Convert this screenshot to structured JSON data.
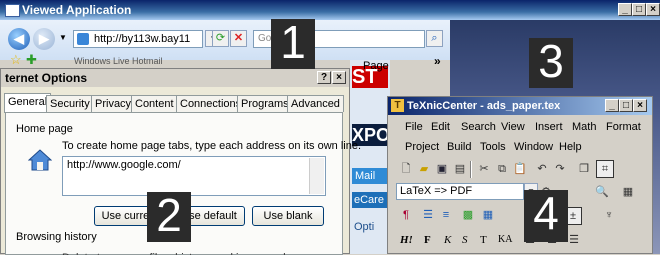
{
  "outer_window": {
    "title": "Viewed Application",
    "controls": [
      "_",
      "□",
      "×"
    ]
  },
  "ie": {
    "address": "http://by113w.bay11",
    "search_placeholder": "Google",
    "page_menu": "Page",
    "chevron": "»",
    "tab_label": "Windows Live Hotmail"
  },
  "overlays": [
    "1",
    "2",
    "3",
    "4"
  ],
  "internet_options": {
    "title": "ternet Options",
    "title_controls": [
      "?",
      "×"
    ],
    "tabs": [
      "General",
      "Security",
      "Privacy",
      "Content",
      "Connections",
      "Programs",
      "Advanced"
    ],
    "home_page_label": "Home page",
    "home_desc": "To create home page tabs, type each address on its own line.",
    "home_url": "http://www.google.com/",
    "buttons": [
      "Use current",
      "Use default",
      "Use blank"
    ],
    "browsing_history_label": "Browsing history",
    "cut_text": "Delete temporary files, history, cookies, saved passwords"
  },
  "background_page": {
    "fragments": [
      "ST",
      "XPO",
      "Mail",
      "eCare",
      "Opti"
    ]
  },
  "texnic": {
    "title": "TeXnicCenter - ads_paper.tex",
    "controls": [
      "_",
      "□",
      "×"
    ],
    "menu1": [
      "File",
      "Edit",
      "Search",
      "View",
      "Insert",
      "Math",
      "Format"
    ],
    "menu2": [
      "Project",
      "Build",
      "Tools",
      "Window",
      "Help"
    ],
    "profile": "LaTeX => PDF",
    "format_tools": [
      "H!",
      "F",
      "K",
      "S",
      "T",
      "KA"
    ]
  },
  "colors": {
    "titlebar": "#0a246a",
    "dialog_bg": "#ece9d8",
    "overlay_bg": "#2b2b2b"
  }
}
